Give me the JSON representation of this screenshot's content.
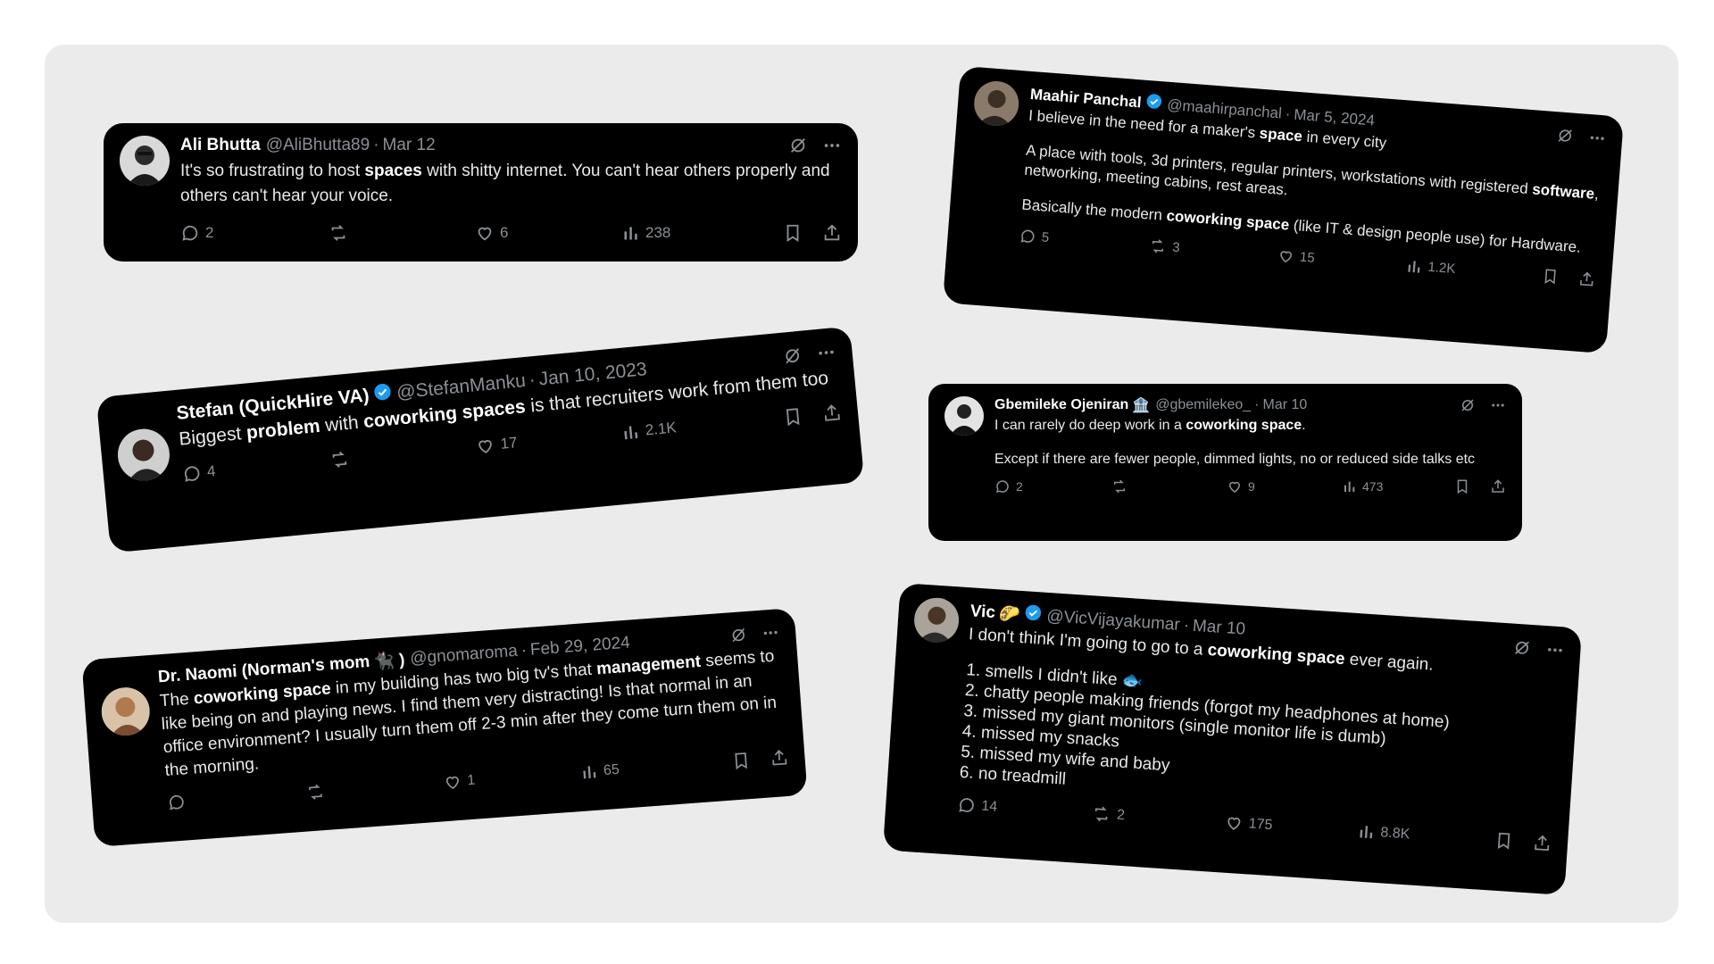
{
  "tweets": [
    {
      "name": "Ali Bhutta",
      "verified": false,
      "emoji": "",
      "handle": "@AliBhutta89",
      "date": "Mar 12",
      "p1": [
        "It's so frustrating to host ",
        "spaces",
        " with shitty internet. You can't hear others properly and others can't hear your voice."
      ],
      "replies": "2",
      "retweets": "",
      "likes": "6",
      "views": "238"
    },
    {
      "name": "Maahir Panchal",
      "verified": true,
      "emoji": "",
      "handle": "@maahirpanchal",
      "date": "Mar 5, 2024",
      "p1": [
        "I believe in the need for a maker's ",
        "space",
        " in every city"
      ],
      "p2": [
        "A place with tools, 3d printers, regular printers, workstations with registered ",
        "software",
        ", networking, meeting cabins, rest areas."
      ],
      "p3": [
        "Basically the modern ",
        "coworking space",
        " (like IT & design people use) for Hardware."
      ],
      "replies": "5",
      "retweets": "3",
      "likes": "15",
      "views": "1.2K"
    },
    {
      "name": "Stefan (QuickHire VA)",
      "verified": true,
      "emoji": "",
      "handle": "@StefanManku",
      "date": "Jan 10, 2023",
      "p1": [
        "Biggest ",
        "problem",
        " with ",
        "coworking spaces",
        " is that recruiters work from them too"
      ],
      "replies": "4",
      "retweets": "",
      "likes": "17",
      "views": "2.1K"
    },
    {
      "name": "Gbemileke Ojeniran",
      "verified": false,
      "emoji": "🏦",
      "handle": "@gbemilekeo_",
      "date": "Mar 10",
      "p1": [
        "I can rarely do deep work in a ",
        "coworking space",
        "."
      ],
      "p2": [
        "Except if there are fewer people, dimmed lights, no or reduced side talks etc"
      ],
      "replies": "2",
      "retweets": "",
      "likes": "9",
      "views": "473"
    },
    {
      "name": "Dr. Naomi (Norman's mom",
      "verified": false,
      "emoji": "🐈‍⬛ )",
      "handle": "@gnomaroma",
      "date": "Feb 29, 2024",
      "p1": [
        "The ",
        "coworking space",
        " in my building has two big tv's that ",
        "management",
        " seems to like being on and playing news.  I find them very distracting!  Is that normal in an office environment?  I usually turn them off 2-3 min after they come turn them on in the morning."
      ],
      "replies": "",
      "retweets": "",
      "likes": "1",
      "views": "65"
    },
    {
      "name": "Vic",
      "verified": true,
      "emoji": "🌮",
      "handle": "@VicVijayakumar",
      "date": "Mar 10",
      "p1": [
        "I don't think I'm going to go to a ",
        "coworking space",
        " ever again."
      ],
      "list": [
        "1. smells I didn't like 🐟",
        "2. chatty people making friends (forgot my headphones at home)",
        "3. missed my giant monitors (single monitor life is dumb)",
        "4. missed my snacks",
        "5. missed my wife and baby",
        "6. no treadmill"
      ],
      "replies": "14",
      "retweets": "2",
      "likes": "175",
      "views": "8.8K"
    }
  ],
  "colors": {
    "card": "#000000",
    "board": "#ebebeb",
    "muted": "#8b9096",
    "verified": "#1d9bf0"
  },
  "icons": [
    "grok-icon",
    "more-icon",
    "reply-icon",
    "retweet-icon",
    "like-icon",
    "views-icon",
    "bookmark-icon",
    "share-icon",
    "verified-badge-icon"
  ]
}
